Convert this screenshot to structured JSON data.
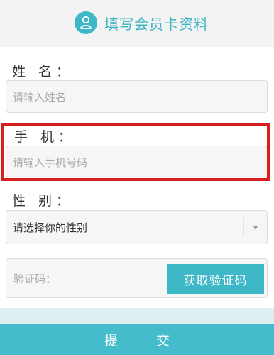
{
  "header": {
    "title": "填写会员卡资料",
    "icon": "user-icon",
    "accent_color": "#3eb8c7"
  },
  "form": {
    "name": {
      "label": "姓 名：",
      "placeholder": "请输入姓名"
    },
    "phone": {
      "label": "手 机：",
      "placeholder": "请输入手机号码",
      "highlight_color": "#d62020"
    },
    "gender": {
      "label": "性 别：",
      "selected": "请选择你的性别"
    },
    "code": {
      "placeholder": "验证码：",
      "button_label": "获取验证码"
    }
  },
  "submit": {
    "label": "提 交"
  }
}
